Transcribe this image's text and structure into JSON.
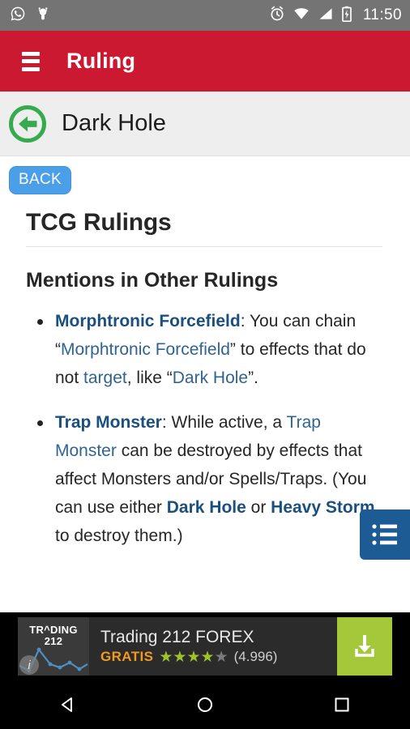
{
  "status_bar": {
    "time": "11:50",
    "icons": [
      "whatsapp-icon",
      "android-icon",
      "alarm-icon",
      "wifi-icon",
      "signal-icon",
      "battery-charging-icon"
    ],
    "background_color": "#747474"
  },
  "app_bar": {
    "menu_icon": "hamburger-menu-icon",
    "title": "Ruling",
    "background_color": "#cc1932"
  },
  "sub_header": {
    "back_icon": "back-arrow-circle-icon",
    "title": "Dark Hole",
    "background_color": "#eeeeee"
  },
  "content": {
    "back_button": "BACK",
    "heading_primary": "TCG Rulings",
    "heading_secondary": "Mentions in Other Rulings",
    "rulings": [
      {
        "link_label": "Morphtronic Forcefield",
        "parts": [
          {
            "type": "link-bold",
            "text": "Morphtronic Forcefield"
          },
          {
            "type": "text",
            "text": ": You can chain “"
          },
          {
            "type": "link",
            "text": "Morphtronic Forcefield"
          },
          {
            "type": "text",
            "text": "” to effects that do not "
          },
          {
            "type": "link",
            "text": "target"
          },
          {
            "type": "text",
            "text": ", like “"
          },
          {
            "type": "link",
            "text": "Dark Hole"
          },
          {
            "type": "text",
            "text": "”."
          }
        ]
      },
      {
        "link_label": "Trap Monster",
        "parts": [
          {
            "type": "link-bold",
            "text": "Trap Monster"
          },
          {
            "type": "text",
            "text": ": While active, a "
          },
          {
            "type": "link",
            "text": "Trap Monster"
          },
          {
            "type": "text",
            "text": " can be destroyed by effects that affect Monsters and/or Spells/Traps. (You can use either "
          },
          {
            "type": "link-bold",
            "text": "Dark Hole"
          },
          {
            "type": "text",
            "text": " or "
          },
          {
            "type": "link-bold",
            "text": "Heavy Storm"
          },
          {
            "type": "text",
            "text": " to destroy them.)"
          }
        ]
      }
    ],
    "link_color": "#2f6491",
    "link_bold_color": "#1b4f7e"
  },
  "floating_button": {
    "icon": "bulleted-list-icon",
    "color": "#1d5b94"
  },
  "ad": {
    "logo_line1": "TR^DING",
    "logo_line2": "212",
    "info_badge": "i",
    "title": "Trading 212 FOREX",
    "price_label": "GRATIS",
    "rating_filled": 4,
    "rating_total": 5,
    "rating_count": "(4.996)",
    "download_icon": "download-icon",
    "download_color": "#a5c83a",
    "price_color": "#f09a1e"
  },
  "nav_bar": {
    "back_icon": "nav-back-triangle-icon",
    "home_icon": "nav-home-circle-icon",
    "recents_icon": "nav-recents-square-icon"
  }
}
